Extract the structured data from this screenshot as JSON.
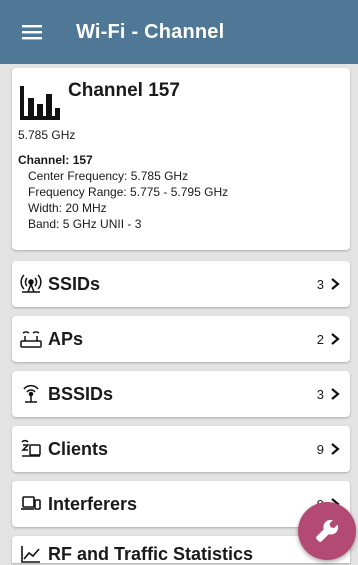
{
  "appbar": {
    "title": "Wi-Fi - Channel",
    "menu_icon": "hamburger-menu-icon"
  },
  "summary": {
    "title": "Channel 157",
    "frequency": "5.785 GHz",
    "channel_label": "Channel:",
    "channel_value": "157",
    "center_freq": "Center Frequency:  5.785 GHz",
    "freq_range": "Frequency Range:  5.775 - 5.795 GHz",
    "width": "Width:  20 MHz",
    "band": "Band:  5 GHz UNII - 3"
  },
  "nav": [
    {
      "label": "SSIDs",
      "count": "3",
      "icon": "broadcast-icon"
    },
    {
      "label": "APs",
      "count": "2",
      "icon": "access-point-icon"
    },
    {
      "label": "BSSIDs",
      "count": "3",
      "icon": "antenna-icon"
    },
    {
      "label": "Clients",
      "count": "9",
      "icon": "devices-icon"
    },
    {
      "label": "Interferers",
      "count": "9",
      "icon": "laptop-icon"
    },
    {
      "label": "RF and Traffic Statistics",
      "count": "",
      "icon": "line-chart-icon"
    }
  ],
  "fab": {
    "icon": "wrench-icon"
  },
  "colors": {
    "appbar": "#4f7896",
    "fab": "#b24a73",
    "background": "#e3e3e3"
  }
}
